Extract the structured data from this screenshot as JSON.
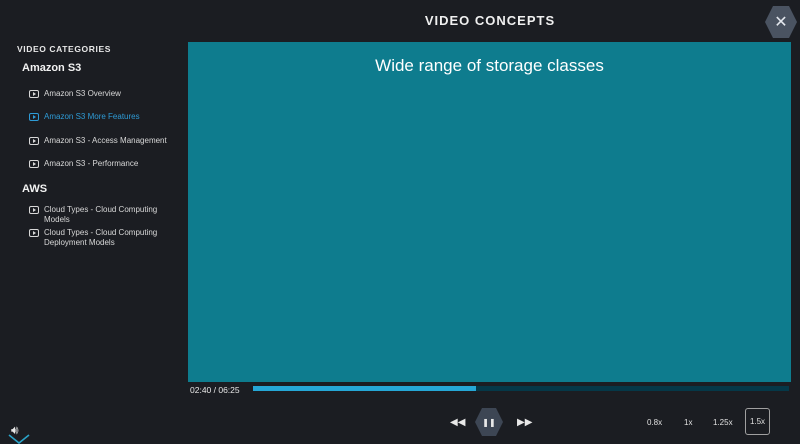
{
  "header": {
    "title": "VIDEO CONCEPTS",
    "close_label": "✕"
  },
  "sidebar": {
    "heading": "VIDEO CATEGORIES",
    "groups": [
      {
        "title": "Amazon S3",
        "items": [
          {
            "label": "Amazon S3 Overview"
          },
          {
            "label": "Amazon S3 More Features"
          },
          {
            "label": "Amazon S3 - Access Management"
          },
          {
            "label": "Amazon S3 - Performance"
          }
        ]
      },
      {
        "title": "AWS",
        "items": [
          {
            "label": "Cloud Types - Cloud Computing Models"
          },
          {
            "label": "Cloud Types - Cloud Computing Deployment Models"
          }
        ]
      }
    ],
    "active_item": "Amazon S3 More Features"
  },
  "video": {
    "slide_text": "Wide range of storage classes"
  },
  "player": {
    "time": "02:40 / 06:25",
    "progress": 0.416,
    "icons": {
      "volume": "volume-icon",
      "rewind": "rewind-icon",
      "pause": "pause-icon",
      "forward": "fast-forward-icon"
    },
    "speeds": [
      "0.8x",
      "1x",
      "1.25x",
      "1.5x"
    ],
    "selected_speed": "1.5x"
  },
  "colors": {
    "background": "#1b1d22",
    "video_bg": "#0e7c8e",
    "accent": "#2e9bd6",
    "progress_fill": "#25a7d6"
  }
}
